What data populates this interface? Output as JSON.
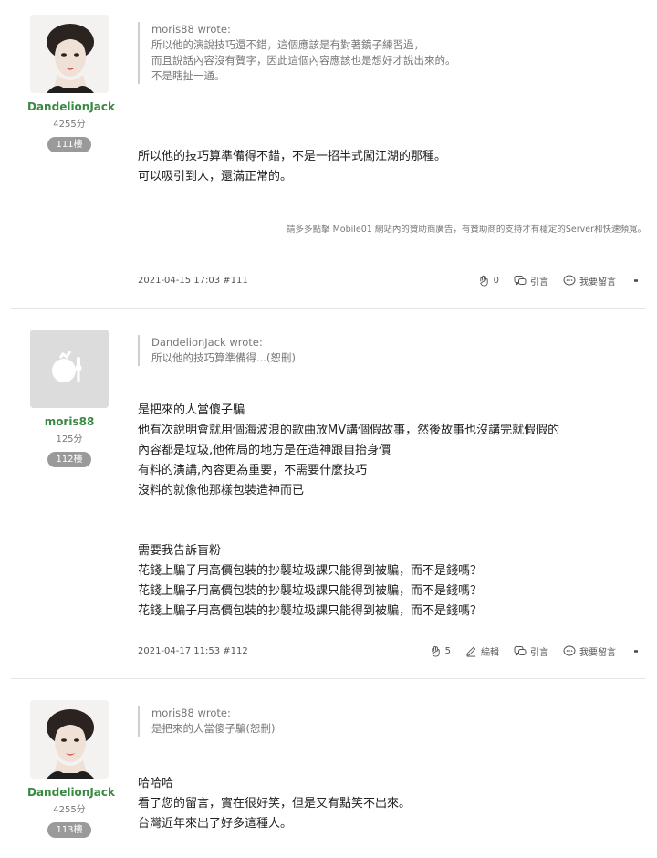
{
  "sponsor_text": "請多多點擊 Mobile01 網站內的贊助商廣告，有贊助商的支持才有穩定的Server和快速頻寬。",
  "actions": {
    "quote": "引言",
    "reply": "我要留言",
    "edit": "編輯"
  },
  "posts": [
    {
      "username": "DandelionJack",
      "score": "4255分",
      "floor": "111樓",
      "quote_lines": [
        "moris88 wrote:",
        "所以他的演說技巧還不錯，這個應該是有對著鏡子練習過，",
        "而且說話內容沒有贅字，因此這個內容應該也是想好才說出來的。",
        "不是瞎扯一通。"
      ],
      "body_lines": [
        "所以他的技巧算準備得不錯，不是一招半式闖江湖的那種。",
        "可以吸引到人，還滿正常的。"
      ],
      "date": "2021-04-15 17:03 #111",
      "likes": "0"
    },
    {
      "username": "moris88",
      "score": "125分",
      "floor": "112樓",
      "quote_lines": [
        "DandelionJack wrote:",
        "所以他的技巧算準備得...(恕刪)"
      ],
      "body_lines": [
        "是把來的人當傻子騙",
        "他有次說明會就用個海波浪的歌曲放MV講個假故事，然後故事也沒講完就假假的",
        "內容都是垃圾,他佈局的地方是在造神跟自抬身價",
        "有料的演講,內容更為重要，不需要什麼技巧",
        "沒料的就像他那樣包裝造神而已",
        "",
        "",
        "需要我告訴盲粉",
        "花錢上騙子用高價包裝的抄襲垃圾課只能得到被騙，而不是錢嗎？",
        "花錢上騙子用高價包裝的抄襲垃圾課只能得到被騙，而不是錢嗎？",
        "花錢上騙子用高價包裝的抄襲垃圾課只能得到被騙，而不是錢嗎？"
      ],
      "date": "2021-04-17 11:53 #112",
      "likes": "5"
    },
    {
      "username": "DandelionJack",
      "score": "4255分",
      "floor": "113樓",
      "quote_lines": [
        "moris88 wrote:",
        " 是把來的人當傻子騙(恕刪)"
      ],
      "body_lines": [
        "哈哈哈",
        "看了您的留言，實在很好笑，但是又有點笑不出來。",
        "台灣近年來出了好多這種人。"
      ]
    }
  ]
}
